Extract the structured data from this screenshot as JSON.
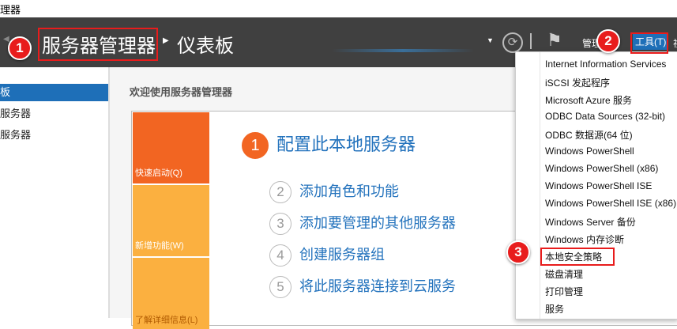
{
  "window": {
    "title": "理器"
  },
  "header": {
    "app": "服务器管理器",
    "page": "仪表板",
    "manage": "管理",
    "tools": "工具(T)",
    "more": "视"
  },
  "sidebar": {
    "items": [
      "板",
      "服务器",
      "服务器"
    ]
  },
  "main": {
    "welcome": "欢迎使用服务器管理器",
    "tiles": [
      "快速启动(Q)",
      "新增功能(W)",
      "了解详细信息(L)"
    ],
    "steps": [
      {
        "n": "1",
        "label": "配置此本地服务器"
      },
      {
        "n": "2",
        "label": "添加角色和功能"
      },
      {
        "n": "3",
        "label": "添加要管理的其他服务器"
      },
      {
        "n": "4",
        "label": "创建服务器组"
      },
      {
        "n": "5",
        "label": "将此服务器连接到云服务"
      }
    ]
  },
  "menu": {
    "items": [
      "Internet Information Services",
      "iSCSI 发起程序",
      "Microsoft Azure 服务",
      "ODBC Data Sources (32-bit)",
      "ODBC 数据源(64 位)",
      "Windows PowerShell",
      "Windows PowerShell (x86)",
      "Windows PowerShell ISE",
      "Windows PowerShell ISE (x86)",
      "Windows Server 备份",
      "Windows 内存诊断",
      "本地安全策略",
      "磁盘清理",
      "打印管理",
      "服务"
    ]
  },
  "badges": [
    "1",
    "2",
    "3"
  ],
  "colors": {
    "accent": "#2473bd",
    "orange": "#f26522",
    "yellow": "#fbb040",
    "badge": "#e81c1c"
  }
}
